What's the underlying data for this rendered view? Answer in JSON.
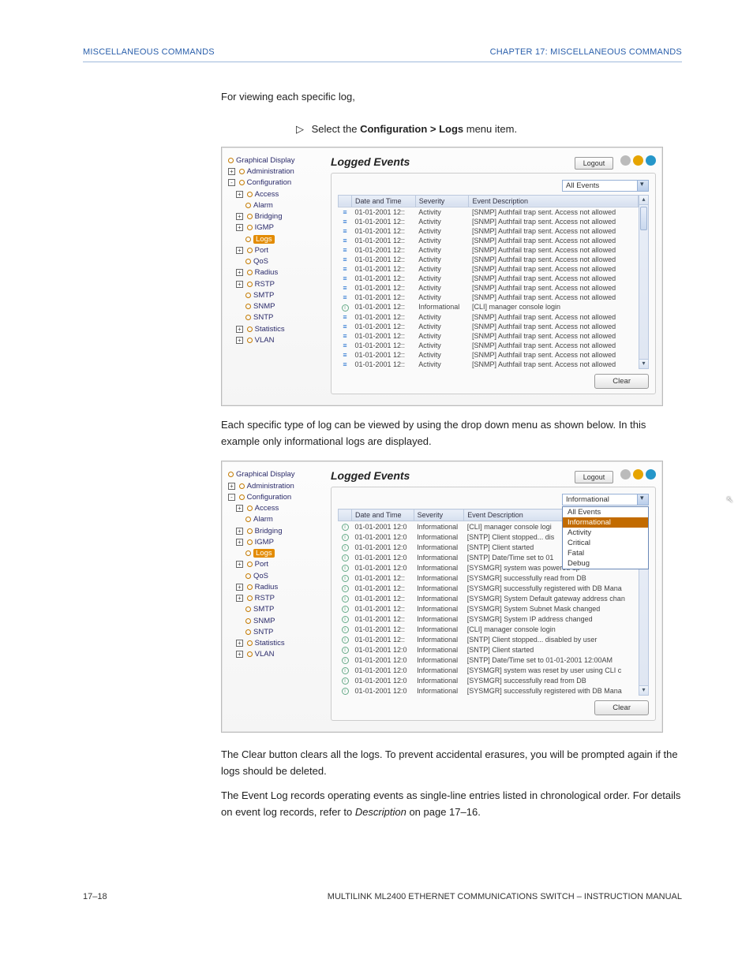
{
  "header": {
    "left": "MISCELLANEOUS COMMANDS",
    "right": "CHAPTER 17: MISCELLANEOUS COMMANDS"
  },
  "intro": "For viewing each specific log,",
  "instruct": {
    "glyph": "▷",
    "pre": "Select the ",
    "bold": "Configuration > Logs",
    "post": " menu item."
  },
  "mid": "Each specific type of log can be viewed by using the drop down menu as shown below. In this example only informational logs are displayed.",
  "closing1": "The Clear button clears all the logs. To prevent accidental erasures, you will be prompted again if the logs should be deleted.",
  "closing2a": "The Event Log records operating events as single-line entries listed in chronological order. For details on event log records, refer to ",
  "closing2b": "Description",
  "closing2c": " on page 17–16.",
  "footer": {
    "left": "17–18",
    "right": "MULTILINK ML2400 ETHERNET COMMUNICATIONS SWITCH – INSTRUCTION MANUAL"
  },
  "ui": {
    "title": "Logged Events",
    "logout": "Logout",
    "clear": "Clear",
    "columns": {
      "c1": "",
      "c2": "Date and Time",
      "c3": "Severity",
      "c4": "Event Description"
    },
    "filter1": "All Events",
    "filter2": "Informational",
    "dd_options": [
      "All Events",
      "Informational",
      "Activity",
      "Critical",
      "Fatal",
      "Debug"
    ]
  },
  "tree": [
    {
      "lv": 0,
      "exp": "",
      "dot": 1,
      "label": "Graphical Display"
    },
    {
      "lv": 0,
      "exp": "+",
      "dot": 1,
      "label": "Administration"
    },
    {
      "lv": 0,
      "exp": "-",
      "dot": 1,
      "label": "Configuration"
    },
    {
      "lv": 1,
      "exp": "+",
      "dot": 1,
      "label": "Access"
    },
    {
      "lv": 2,
      "exp": "",
      "dot": 1,
      "label": "Alarm"
    },
    {
      "lv": 1,
      "exp": "+",
      "dot": 1,
      "label": "Bridging"
    },
    {
      "lv": 1,
      "exp": "+",
      "dot": 1,
      "label": "IGMP"
    },
    {
      "lv": 2,
      "exp": "",
      "dot": 1,
      "label": "Logs",
      "sel": 1
    },
    {
      "lv": 1,
      "exp": "+",
      "dot": 1,
      "label": "Port"
    },
    {
      "lv": 2,
      "exp": "",
      "dot": 1,
      "label": "QoS"
    },
    {
      "lv": 1,
      "exp": "+",
      "dot": 1,
      "label": "Radius"
    },
    {
      "lv": 1,
      "exp": "+",
      "dot": 1,
      "label": "RSTP"
    },
    {
      "lv": 2,
      "exp": "",
      "dot": 1,
      "label": "SMTP"
    },
    {
      "lv": 2,
      "exp": "",
      "dot": 1,
      "label": "SNMP"
    },
    {
      "lv": 2,
      "exp": "",
      "dot": 1,
      "label": "SNTP"
    },
    {
      "lv": 1,
      "exp": "+",
      "dot": 1,
      "label": "Statistics"
    },
    {
      "lv": 1,
      "exp": "+",
      "dot": 1,
      "label": "VLAN"
    }
  ],
  "rows1": [
    {
      "i": "a",
      "dt": "01-01-2001 12::",
      "sev": "Activity",
      "desc": "[SNMP] Authfail trap sent. Access not allowed"
    },
    {
      "i": "a",
      "dt": "01-01-2001 12::",
      "sev": "Activity",
      "desc": "[SNMP] Authfail trap sent. Access not allowed"
    },
    {
      "i": "a",
      "dt": "01-01-2001 12::",
      "sev": "Activity",
      "desc": "[SNMP] Authfail trap sent. Access not allowed"
    },
    {
      "i": "a",
      "dt": "01-01-2001 12::",
      "sev": "Activity",
      "desc": "[SNMP] Authfail trap sent. Access not allowed"
    },
    {
      "i": "a",
      "dt": "01-01-2001 12::",
      "sev": "Activity",
      "desc": "[SNMP] Authfail trap sent. Access not allowed"
    },
    {
      "i": "a",
      "dt": "01-01-2001 12::",
      "sev": "Activity",
      "desc": "[SNMP] Authfail trap sent. Access not allowed"
    },
    {
      "i": "a",
      "dt": "01-01-2001 12::",
      "sev": "Activity",
      "desc": "[SNMP] Authfail trap sent. Access not allowed"
    },
    {
      "i": "a",
      "dt": "01-01-2001 12::",
      "sev": "Activity",
      "desc": "[SNMP] Authfail trap sent. Access not allowed"
    },
    {
      "i": "a",
      "dt": "01-01-2001 12::",
      "sev": "Activity",
      "desc": "[SNMP] Authfail trap sent. Access not allowed"
    },
    {
      "i": "a",
      "dt": "01-01-2001 12::",
      "sev": "Activity",
      "desc": "[SNMP] Authfail trap sent. Access not allowed"
    },
    {
      "i": "i",
      "dt": "01-01-2001 12::",
      "sev": "Informational",
      "desc": "[CLI] manager console login"
    },
    {
      "i": "a",
      "dt": "01-01-2001 12::",
      "sev": "Activity",
      "desc": "[SNMP] Authfail trap sent. Access not allowed"
    },
    {
      "i": "a",
      "dt": "01-01-2001 12::",
      "sev": "Activity",
      "desc": "[SNMP] Authfail trap sent. Access not allowed"
    },
    {
      "i": "a",
      "dt": "01-01-2001 12::",
      "sev": "Activity",
      "desc": "[SNMP] Authfail trap sent. Access not allowed"
    },
    {
      "i": "a",
      "dt": "01-01-2001 12::",
      "sev": "Activity",
      "desc": "[SNMP] Authfail trap sent. Access not allowed"
    },
    {
      "i": "a",
      "dt": "01-01-2001 12::",
      "sev": "Activity",
      "desc": "[SNMP] Authfail trap sent. Access not allowed"
    },
    {
      "i": "a",
      "dt": "01-01-2001 12::",
      "sev": "Activity",
      "desc": "[SNMP] Authfail trap sent. Access not allowed"
    }
  ],
  "rows2": [
    {
      "i": "i",
      "dt": "01-01-2001 12:0",
      "sev": "Informational",
      "desc": "[CLI] manager console logi"
    },
    {
      "i": "i",
      "dt": "01-01-2001 12:0",
      "sev": "Informational",
      "desc": "[SNTP] Client stopped... dis"
    },
    {
      "i": "i",
      "dt": "01-01-2001 12:0",
      "sev": "Informational",
      "desc": "[SNTP] Client started"
    },
    {
      "i": "i",
      "dt": "01-01-2001 12:0",
      "sev": "Informational",
      "desc": "[SNTP] Date/Time set to 01"
    },
    {
      "i": "i",
      "dt": "01-01-2001 12:0",
      "sev": "Informational",
      "desc": "[SYSMGR] system was powered up"
    },
    {
      "i": "i",
      "dt": "01-01-2001 12::",
      "sev": "Informational",
      "desc": "[SYSMGR] successfully read from DB"
    },
    {
      "i": "i",
      "dt": "01-01-2001 12::",
      "sev": "Informational",
      "desc": "[SYSMGR] successfully registered with DB Mana"
    },
    {
      "i": "i",
      "dt": "01-01-2001 12::",
      "sev": "Informational",
      "desc": "[SYSMGR] System Default gateway address chan"
    },
    {
      "i": "i",
      "dt": "01-01-2001 12::",
      "sev": "Informational",
      "desc": "[SYSMGR] System Subnet Mask changed"
    },
    {
      "i": "i",
      "dt": "01-01-2001 12::",
      "sev": "Informational",
      "desc": "[SYSMGR] System IP address changed"
    },
    {
      "i": "i",
      "dt": "01-01-2001 12::",
      "sev": "Informational",
      "desc": "[CLI] manager console login"
    },
    {
      "i": "i",
      "dt": "01-01-2001 12::",
      "sev": "Informational",
      "desc": "[SNTP] Client stopped... disabled by user"
    },
    {
      "i": "i",
      "dt": "01-01-2001 12:0",
      "sev": "Informational",
      "desc": "[SNTP] Client started"
    },
    {
      "i": "i",
      "dt": "01-01-2001 12:0",
      "sev": "Informational",
      "desc": "[SNTP] Date/Time set to 01-01-2001 12:00AM"
    },
    {
      "i": "i",
      "dt": "01-01-2001 12:0",
      "sev": "Informational",
      "desc": "[SYSMGR] system was reset by user using CLI c"
    },
    {
      "i": "i",
      "dt": "01-01-2001 12:0",
      "sev": "Informational",
      "desc": "[SYSMGR] successfully read from DB"
    },
    {
      "i": "i",
      "dt": "01-01-2001 12:0",
      "sev": "Informational",
      "desc": "[SYSMGR] successfully registered with DB Mana"
    }
  ]
}
